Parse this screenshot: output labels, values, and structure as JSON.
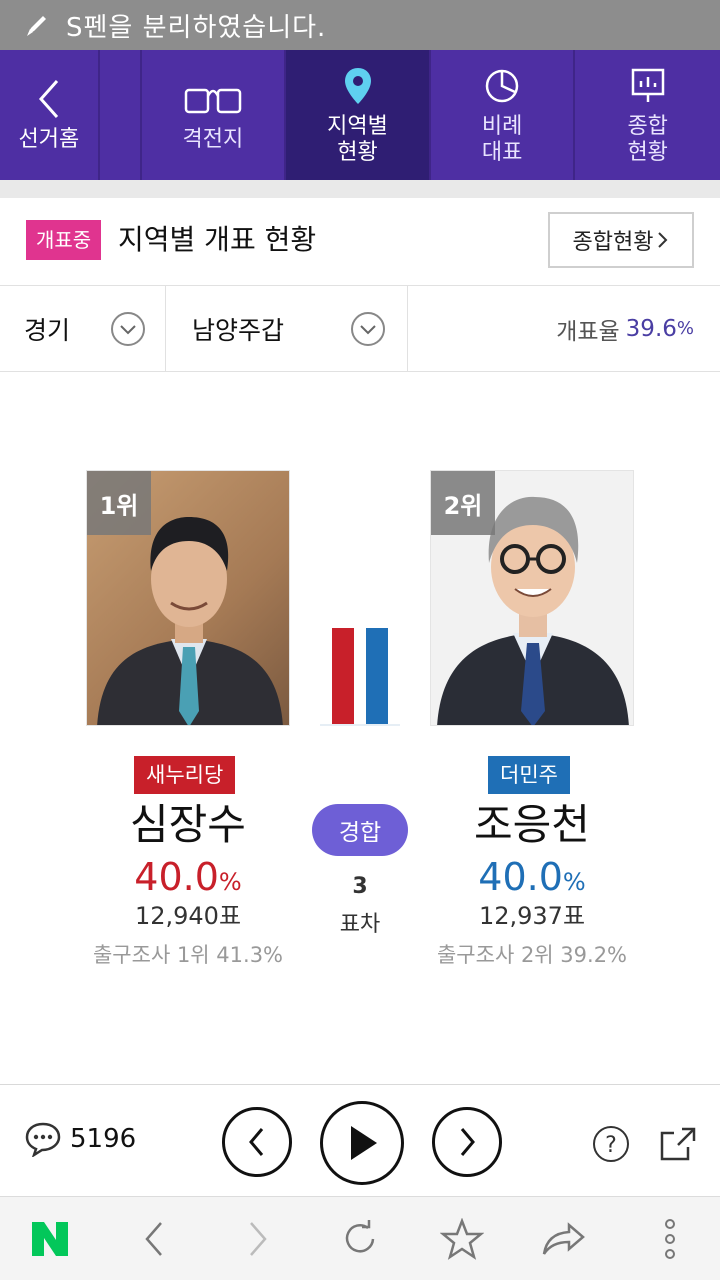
{
  "status_bar": {
    "message": "S펜을 분리하였습니다."
  },
  "nav": {
    "back_label": "선거홈",
    "tabs": [
      {
        "label": "격전지",
        "icon": "battleground-icon",
        "active": false
      },
      {
        "label": "지역별\n현황",
        "line1": "지역별",
        "line2": "현황",
        "icon": "location-pin-icon",
        "active": true
      },
      {
        "label": "비례\n대표",
        "line1": "비례",
        "line2": "대표",
        "icon": "pie-chart-icon",
        "active": false
      },
      {
        "label": "종합\n현황",
        "line1": "종합",
        "line2": "현황",
        "icon": "board-chart-icon",
        "active": false
      }
    ]
  },
  "header": {
    "badge": "개표중",
    "title": "지역별 개표 현황",
    "summary_button": "종합현황"
  },
  "selectors": {
    "region": "경기",
    "district": "남양주갑",
    "count_rate_label": "개표율",
    "count_rate_value": "39.6",
    "count_rate_unit": "%"
  },
  "candidates": [
    {
      "rank": "1위",
      "party": "새누리당",
      "name": "심장수",
      "percent": "40.0",
      "percent_unit": "%",
      "votes": "12,940표",
      "exit_poll": "출구조사 1위 41.3%",
      "color": "#c8202a",
      "vote_share": 40.0
    },
    {
      "rank": "2위",
      "party": "더민주",
      "name": "조응천",
      "percent": "40.0",
      "percent_unit": "%",
      "votes": "12,937표",
      "exit_poll": "출구조사 2위 39.2%",
      "color": "#1f6fb6",
      "vote_share": 40.0
    }
  ],
  "race": {
    "status": "경합",
    "gap": "3",
    "gap_label": "표차"
  },
  "controls": {
    "comment_count": "5196"
  },
  "colors": {
    "nav_bg": "#4e2fa3",
    "nav_active": "#2f1e73",
    "live_badge": "#e0348f",
    "status_pill": "#6e5fd6",
    "brand_green": "#03c75a"
  }
}
